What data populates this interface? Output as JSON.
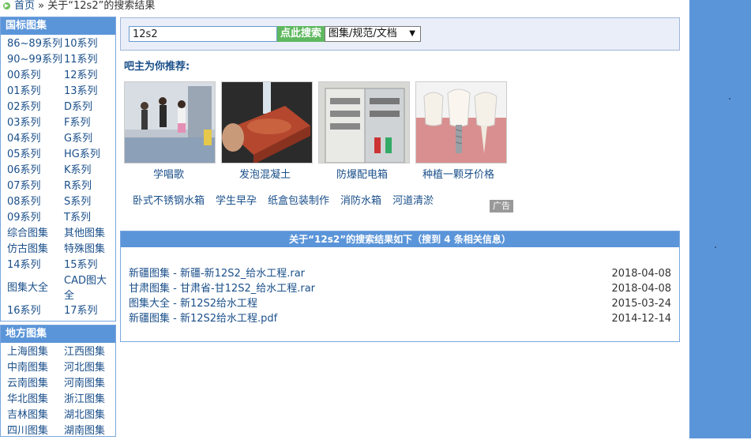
{
  "breadcrumb": {
    "home": "首页",
    "sep": "»",
    "current": "关于“12s2”的搜索结果"
  },
  "sidebar": {
    "national_title": "国标图集",
    "national_items": [
      "86~89系列",
      "10系列",
      "90~99系列",
      "11系列",
      "00系列",
      "12系列",
      "01系列",
      "13系列",
      "02系列",
      "D系列",
      "03系列",
      "F系列",
      "04系列",
      "G系列",
      "05系列",
      "HG系列",
      "06系列",
      "K系列",
      "07系列",
      "R系列",
      "08系列",
      "S系列",
      "09系列",
      "T系列",
      "综合图集",
      "其他图集",
      "仿古图集",
      "特殊图集",
      "14系列",
      "15系列",
      "图集大全",
      "CAD图大全",
      "16系列",
      "17系列"
    ],
    "regional_title": "地方图集",
    "regional_items": [
      "上海图集",
      "江西图集",
      "中南图集",
      "河北图集",
      "云南图集",
      "河南图集",
      "华北图集",
      "浙江图集",
      "吉林图集",
      "湖北图集",
      "四川图集",
      "湖南图集"
    ]
  },
  "search": {
    "value": "12s2",
    "button": "点此搜索",
    "type_selected": "图集/规范/文档"
  },
  "recommend": {
    "title": "吧主为你推荐:",
    "cards": [
      {
        "label": "学唱歌"
      },
      {
        "label": "发泡混凝土"
      },
      {
        "label": "防爆配电箱"
      },
      {
        "label": "种植一颗牙价格"
      }
    ],
    "links": [
      "卧式不锈钢水箱",
      "学生早孕",
      "纸盒包装制作",
      "消防水箱",
      "河道清淤"
    ],
    "ad": "广告"
  },
  "results": {
    "header": "关于“12s2”的搜索结果如下（搜到 4 条相关信息）",
    "rows": [
      {
        "title": "新疆图集 - 新疆-新12S2_给水工程.rar",
        "date": "2018-04-08"
      },
      {
        "title": "甘肃图集 - 甘肃省-甘12S2_给水工程.rar",
        "date": "2018-04-08"
      },
      {
        "title": "图集大全 - 新12S2给水工程",
        "date": "2015-03-24"
      },
      {
        "title": "新疆图集 - 新12S2给水工程.pdf",
        "date": "2014-12-14"
      }
    ]
  },
  "colors": {
    "accent": "#5b95d9",
    "link": "#1a4f8a",
    "search_button": "#5fb85f"
  }
}
